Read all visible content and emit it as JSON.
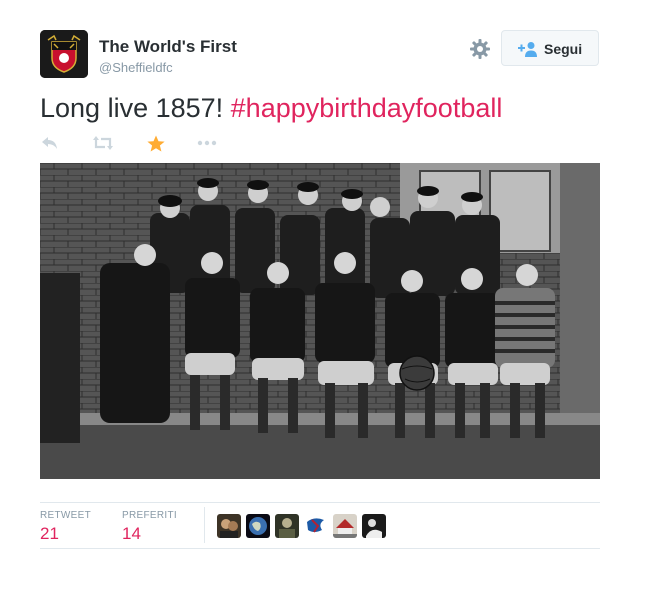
{
  "account": {
    "name": "The World's First",
    "handle": "@Sheffieldfc"
  },
  "follow_button": {
    "label": "Segui",
    "icon": "person-plus-icon"
  },
  "settings": {
    "icon": "gear-icon"
  },
  "tweet": {
    "text_plain": "Long live 1857! ",
    "hashtag": "#happybirthdayfootball"
  },
  "actions": [
    {
      "icon": "reply-icon"
    },
    {
      "icon": "retweet-icon"
    },
    {
      "icon": "favorite-star-icon",
      "active": true
    },
    {
      "icon": "more-icon"
    }
  ],
  "stats": {
    "retweet_label": "RETWEET",
    "retweet_count": "21",
    "favorites_label": "PREFERITI",
    "favorites_count": "14"
  },
  "colors": {
    "hashtag": "#e0245e",
    "star_active": "#ffac33",
    "muted": "#8899a6",
    "text": "#292f33"
  }
}
